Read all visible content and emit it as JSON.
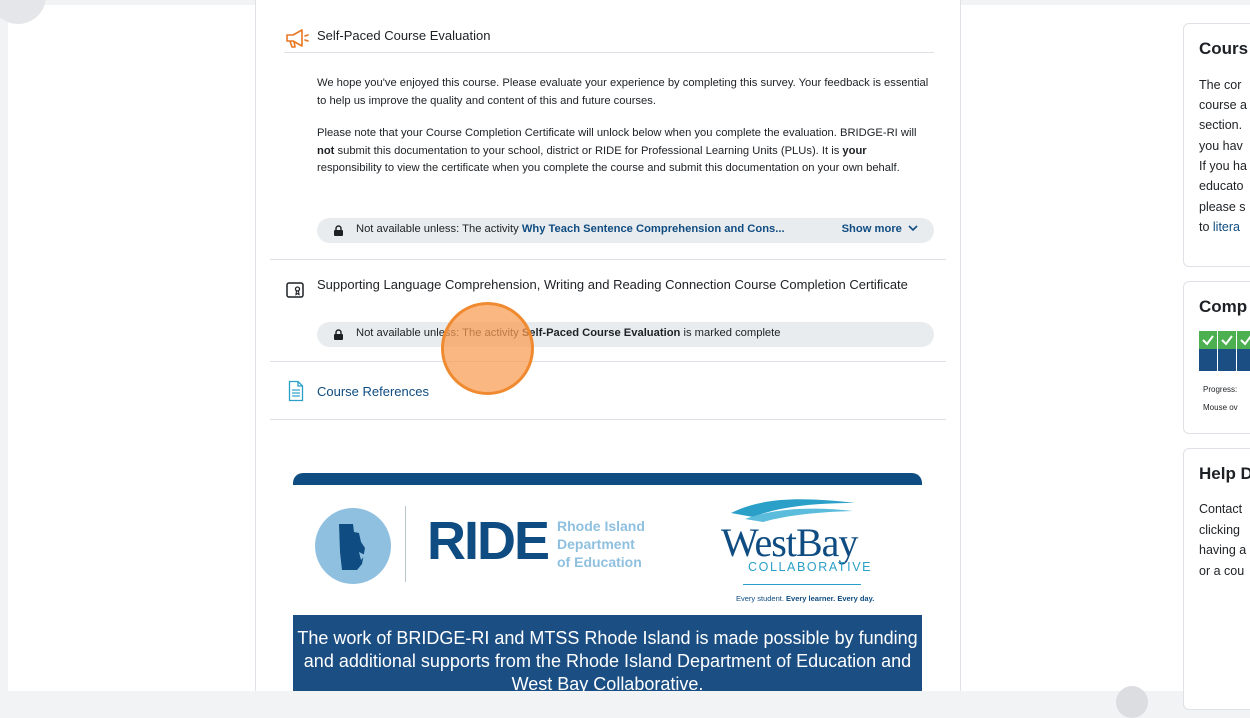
{
  "evaluation": {
    "title": "Self-Paced Course Evaluation",
    "paragraph1": "We hope you've enjoyed this course. Please evaluate your experience by completing this survey. Your feedback is essential to help us improve the quality and content of this and future courses.",
    "p2_a": "Please note that your Course Completion Certificate will unlock below when you complete the evaluation. BRIDGE-RI will ",
    "p2_bold1": "not",
    "p2_b": " submit this documentation to your school, district or RIDE for Professional Learning Units (PLUs). It is ",
    "p2_bold2": "your",
    "p2_c": " responsibility to view the certificate when you complete the course and submit this documentation on your own behalf.",
    "restriction_prefix": "Not available unless: The activity ",
    "restriction_activity": "Why Teach Sentence Comprehension and Cons...",
    "show_more": "Show more"
  },
  "certificate": {
    "title": "Supporting Language Comprehension, Writing and Reading Connection Course Completion Certificate",
    "restriction_prefix": "Not available unless: The activity ",
    "restriction_activity": "Self-Paced Course Evaluation",
    "restriction_suffix": " is marked complete"
  },
  "references": {
    "link": "Course References"
  },
  "banner": {
    "ride_acronym": "RIDE",
    "ride_line1": "Rhode Island",
    "ride_line2": "Department",
    "ride_line3": "of Education",
    "westbay_name": "WestBay",
    "westbay_sub": "COLLABORATIVE",
    "westbay_tag_a": "Every student. ",
    "westbay_tag_b": "Every learner. Every day.",
    "funding_text": "The work of BRIDGE-RI and MTSS Rhode Island is made possible by funding and additional supports from the Rhode Island Department of Education and West Bay Collaborative."
  },
  "sidebar": {
    "course_block": {
      "title": "Cours",
      "lines": [
        "The cor",
        "course a",
        "section.",
        "you hav",
        "If you ha",
        "educato",
        "please s"
      ],
      "last_prefix": "to ",
      "last_link": "litera"
    },
    "completion_block": {
      "title": "Comp",
      "progress_label": "Progress:",
      "hint": "Mouse ov",
      "completed_cells": 3
    },
    "help_block": {
      "title": "Help D",
      "lines": [
        "Contact",
        "clicking",
        "having a",
        "or a cou"
      ]
    }
  },
  "colors": {
    "accent": "#0f4c81",
    "megaphone": "#e87722",
    "complete": "#4caf50",
    "cursor": "#f08a30"
  }
}
